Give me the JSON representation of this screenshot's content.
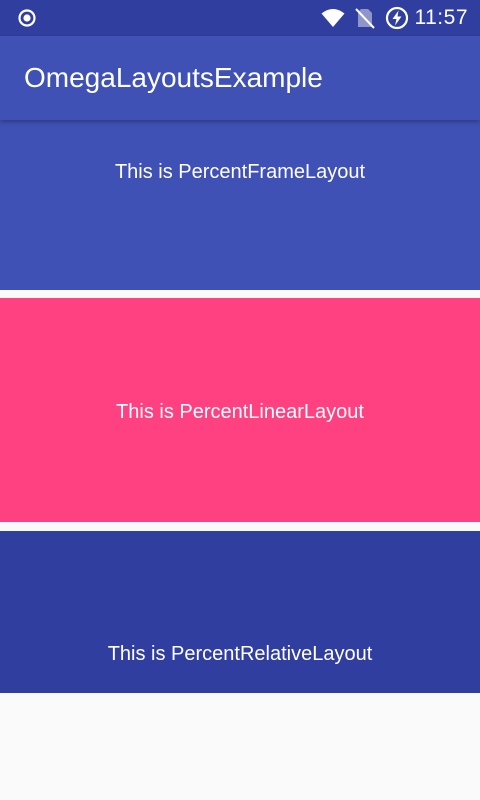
{
  "status_bar": {
    "time": "11:57",
    "icons": [
      "record-icon",
      "wifi-icon",
      "no-sim-icon",
      "battery-charging-icon"
    ]
  },
  "app_bar": {
    "title": "OmegaLayoutsExample"
  },
  "panels": [
    {
      "label": "This is PercentFrameLayout",
      "color": "#3F51B5"
    },
    {
      "label": "This is PercentLinearLayout",
      "color": "#FF4081"
    },
    {
      "label": "This is PercentRelativeLayout",
      "color": "#303F9F"
    }
  ],
  "colors": {
    "primary": "#3F51B5",
    "primary_dark": "#303F9F",
    "accent": "#FF4081",
    "background": "#FAFAFA"
  }
}
